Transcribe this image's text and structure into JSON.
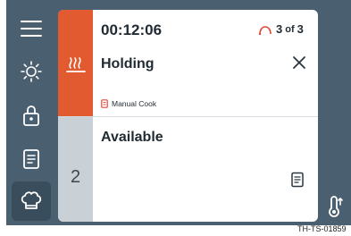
{
  "sidebar": {
    "items": [
      {
        "icon": "menu-icon"
      },
      {
        "icon": "brightness-icon"
      },
      {
        "icon": "lock-icon"
      },
      {
        "icon": "recipes-icon"
      },
      {
        "icon": "chef-hat-icon",
        "active": true
      }
    ]
  },
  "slots": [
    {
      "timer": "00:12:06",
      "probe_count": "3",
      "probe_of": "of",
      "probe_total": "3",
      "status": "Holding",
      "mode": "Manual Cook",
      "accent_color": "#e15a30"
    },
    {
      "number": "2",
      "status": "Available",
      "accent_color": "#c9d0d6"
    }
  ],
  "footer_ref": "TH-TS-01859",
  "colors": {
    "panel": "#4a5f6f",
    "active_nav": "#3a4d5c",
    "alert": "#e04a3a"
  }
}
